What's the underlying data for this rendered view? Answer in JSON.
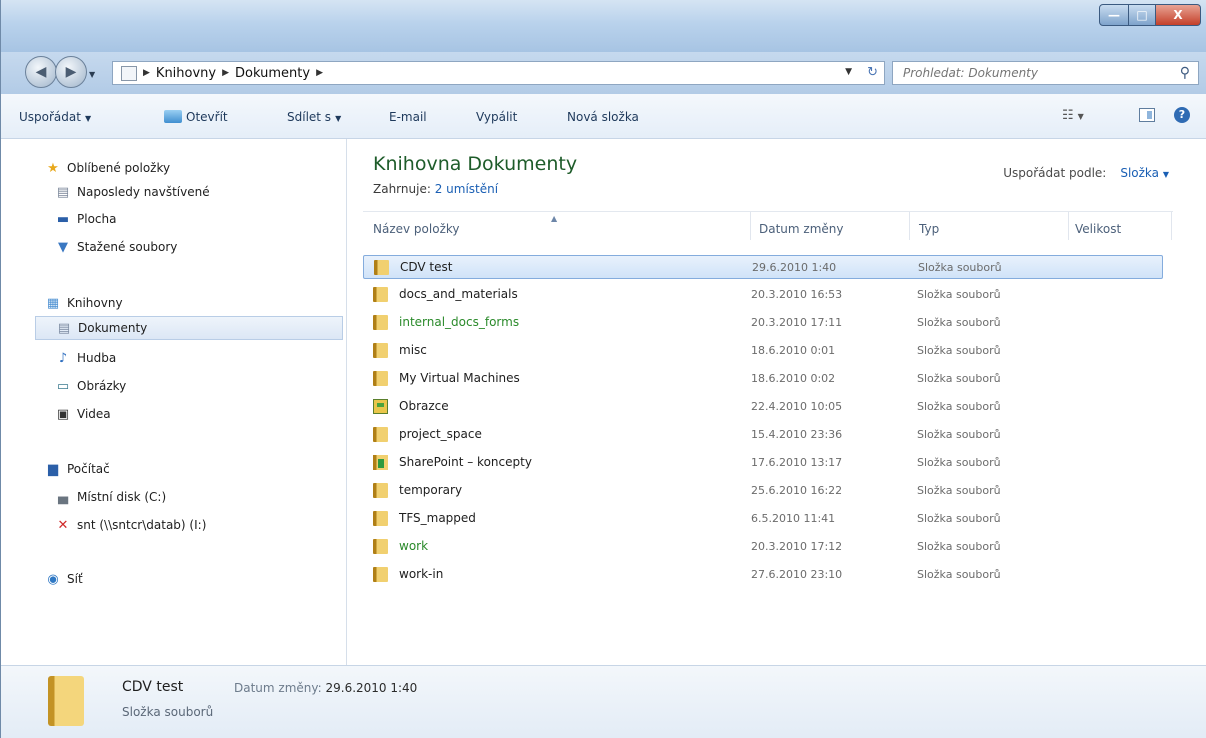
{
  "window": {
    "minimize": "—",
    "maximize": "□",
    "close": "X"
  },
  "nav": {
    "back_icon": "arrow-left-icon",
    "forward_icon": "arrow-right-icon",
    "breadcrumb": [
      "Knihovny",
      "Dokumenty"
    ],
    "search_placeholder": "Prohledat: Dokumenty"
  },
  "toolbar": {
    "organize": "Uspořádat",
    "open": "Otevřít",
    "share": "Sdílet s",
    "email": "E-mail",
    "burn": "Vypálit",
    "new_folder": "Nová složka"
  },
  "sidebar": {
    "favorites": "Oblíbené položky",
    "recent": "Naposledy navštívené",
    "desktop": "Plocha",
    "downloads": "Stažené soubory",
    "libraries": "Knihovny",
    "documents": "Dokumenty",
    "music": "Hudba",
    "pictures": "Obrázky",
    "videos": "Videa",
    "computer": "Počítač",
    "local_disk": "Místní disk (C:)",
    "network_drive": "snt (\\\\sntcr\\datab) (I:)",
    "network": "Síť"
  },
  "library": {
    "title": "Knihovna Dokumenty",
    "includes_label": "Zahrnuje:",
    "includes_link": "2 umístění",
    "arrange_label": "Uspořádat podle:",
    "arrange_value": "Složka"
  },
  "columns": {
    "name": "Název položky",
    "date": "Datum změny",
    "type": "Typ",
    "size": "Velikost"
  },
  "files": [
    {
      "name": "CDV test",
      "date": "29.6.2010 1:40",
      "type": "Složka souborů",
      "icon": "folder-icon",
      "selected": true
    },
    {
      "name": "docs_and_materials",
      "date": "20.3.2010 16:53",
      "type": "Složka souborů",
      "icon": "folder-icon"
    },
    {
      "name": "internal_docs_forms",
      "date": "20.3.2010 17:11",
      "type": "Složka souborů",
      "icon": "folder-icon",
      "green": true
    },
    {
      "name": "misc",
      "date": "18.6.2010 0:01",
      "type": "Složka souborů",
      "icon": "folder-icon"
    },
    {
      "name": "My Virtual Machines",
      "date": "18.6.2010 0:02",
      "type": "Složka souborů",
      "icon": "folder-icon"
    },
    {
      "name": "Obrazce",
      "date": "22.4.2010 10:05",
      "type": "Složka souborů",
      "icon": "picture-folder-icon"
    },
    {
      "name": "project_space",
      "date": "15.4.2010 23:36",
      "type": "Složka souborů",
      "icon": "folder-icon"
    },
    {
      "name": "SharePoint – koncepty",
      "date": "17.6.2010 13:17",
      "type": "Složka souborů",
      "icon": "sharepoint-folder-icon"
    },
    {
      "name": "temporary",
      "date": "25.6.2010 16:22",
      "type": "Složka souborů",
      "icon": "folder-icon"
    },
    {
      "name": "TFS_mapped",
      "date": "6.5.2010 11:41",
      "type": "Složka souborů",
      "icon": "folder-icon"
    },
    {
      "name": "work",
      "date": "20.3.2010 17:12",
      "type": "Složka souborů",
      "icon": "folder-icon",
      "green": true
    },
    {
      "name": "work-in",
      "date": "27.6.2010 23:10",
      "type": "Složka souborů",
      "icon": "folder-icon"
    }
  ],
  "details": {
    "name": "CDV test",
    "date_label": "Datum změny:",
    "date_value": "29.6.2010 1:40",
    "type": "Složka souborů"
  },
  "colors": {
    "accent": "#1a5fb4",
    "green_title": "#1e5c2a",
    "green_item": "#2a8a2a",
    "selection": "#d0e3f8"
  }
}
